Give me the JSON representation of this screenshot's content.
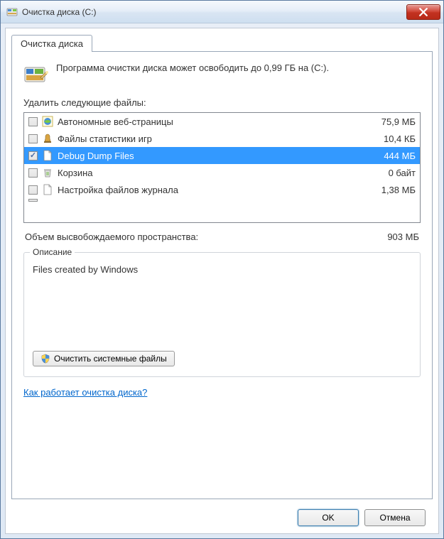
{
  "window": {
    "title": "Очистка диска  (C:)"
  },
  "tab": {
    "label": "Очистка диска"
  },
  "intro": {
    "text": "Программа очистки диска может освободить до 0,99 ГБ на  (C:)."
  },
  "list": {
    "label": "Удалить следующие файлы:",
    "items": [
      {
        "name": "Автономные веб-страницы",
        "size": "75,9 МБ",
        "checked": false,
        "icon": "globe-icon"
      },
      {
        "name": "Файлы статистики игр",
        "size": "10,4 КБ",
        "checked": false,
        "icon": "chess-icon"
      },
      {
        "name": "Debug Dump Files",
        "size": "444 МБ",
        "checked": true,
        "icon": "file-icon",
        "selected": true
      },
      {
        "name": "Корзина",
        "size": "0 байт",
        "checked": false,
        "icon": "recycle-icon"
      },
      {
        "name": "Настройка файлов журнала",
        "size": "1,38 МБ",
        "checked": false,
        "icon": "file-icon"
      }
    ]
  },
  "total": {
    "label": "Объем высвобождаемого пространства:",
    "value": "903 МБ"
  },
  "description": {
    "group_label": "Описание",
    "text": "Files created by Windows"
  },
  "buttons": {
    "clean_system": "Очистить системные файлы",
    "ok": "OK",
    "cancel": "Отмена"
  },
  "help_link": "Как работает очистка диска?"
}
